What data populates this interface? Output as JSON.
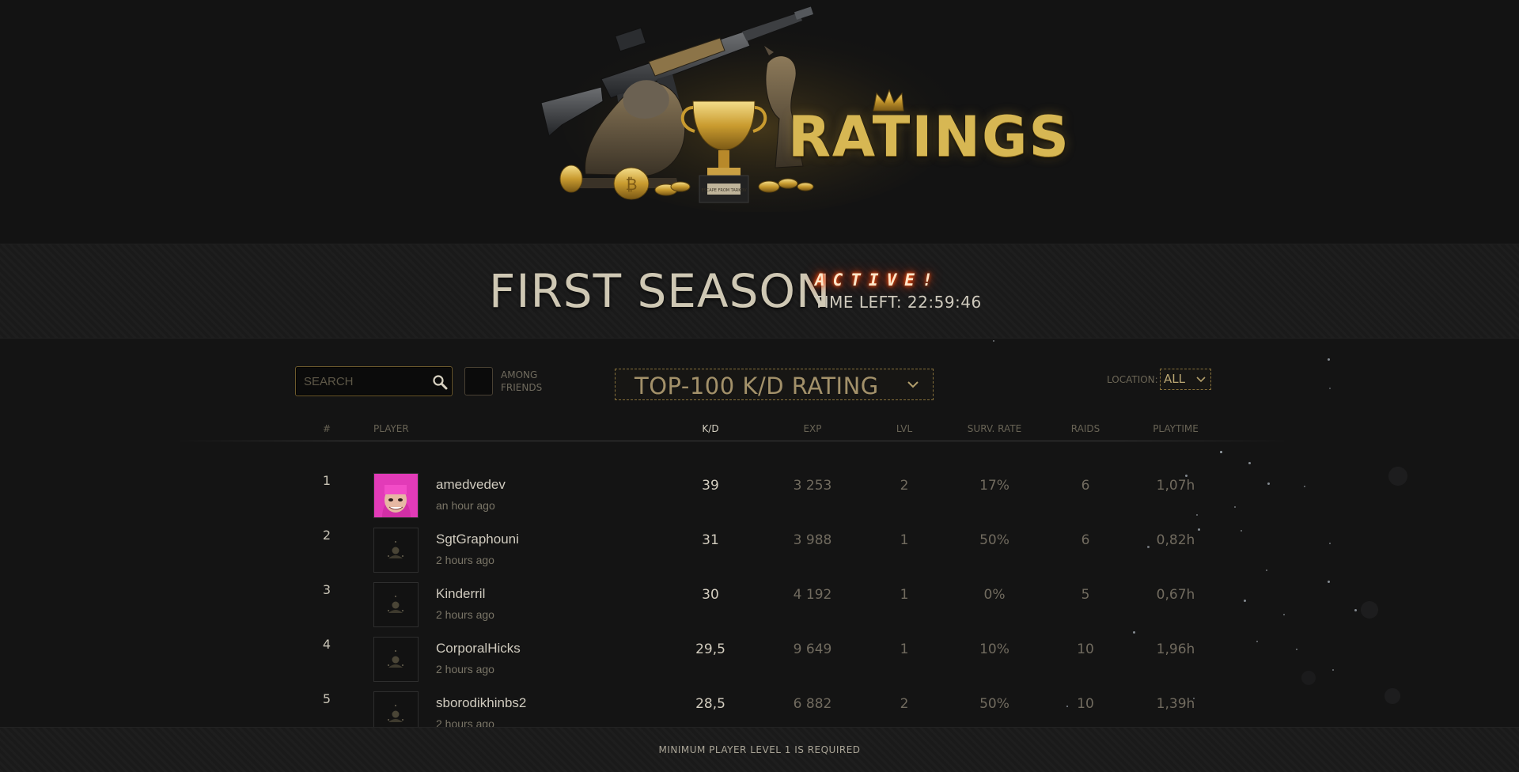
{
  "hero": {
    "logo_text": "RATINGS",
    "plaque_text": "ESCAPE FROM TARKOV"
  },
  "season": {
    "title": "FIRST SEASON",
    "status": "ACTIVE!",
    "time_left": "TIME LEFT: 22:59:46"
  },
  "controls": {
    "search_placeholder": "SEARCH",
    "friends_label": "AMONG FRIENDS",
    "rating_type": "TOP-100 K/D RATING",
    "location_label": "LOCATION:",
    "location_value": "ALL"
  },
  "columns": {
    "rank": "#",
    "player": "PLAYER",
    "kd": "K/D",
    "exp": "EXP",
    "lvl": "LVL",
    "surv_rate": "SURV. RATE",
    "raids": "RAIDS",
    "playtime": "PLAYTIME"
  },
  "players": [
    {
      "rank": "1",
      "name": "amedvedev",
      "last_seen": "an hour ago",
      "kd": "39",
      "exp": "3 253",
      "lvl": "2",
      "surv_rate": "17%",
      "raids": "6",
      "playtime": "1,07h",
      "avatar": "photo-avatar"
    },
    {
      "rank": "2",
      "name": "SgtGraphouni",
      "last_seen": "2 hours ago",
      "kd": "31",
      "exp": "3 988",
      "lvl": "1",
      "surv_rate": "50%",
      "raids": "6",
      "playtime": "0,82h",
      "avatar": "default-avatar"
    },
    {
      "rank": "3",
      "name": "Kinderril",
      "last_seen": "2 hours ago",
      "kd": "30",
      "exp": "4 192",
      "lvl": "1",
      "surv_rate": "0%",
      "raids": "5",
      "playtime": "0,67h",
      "avatar": "default-avatar"
    },
    {
      "rank": "4",
      "name": "CorporalHicks",
      "last_seen": "2 hours ago",
      "kd": "29,5",
      "exp": "9 649",
      "lvl": "1",
      "surv_rate": "10%",
      "raids": "10",
      "playtime": "1,96h",
      "avatar": "default-avatar"
    },
    {
      "rank": "5",
      "name": "sborodikhinbs2",
      "last_seen": "2 hours ago",
      "kd": "28,5",
      "exp": "6 882",
      "lvl": "2",
      "surv_rate": "50%",
      "raids": "10",
      "playtime": "1,39h",
      "avatar": "default-avatar"
    }
  ],
  "footer": {
    "notice": "MINIMUM PLAYER LEVEL 1 IS REQUIRED"
  },
  "colors": {
    "accent_gold": "#d7b753",
    "active_glow": "#ff4a10",
    "background": "#141414"
  }
}
